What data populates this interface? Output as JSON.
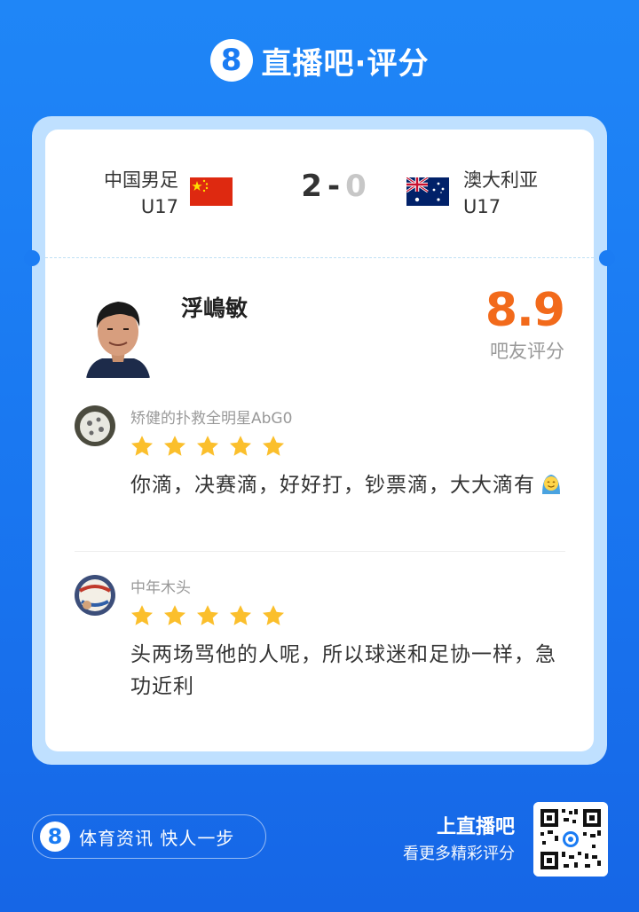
{
  "brand": {
    "badge": "8",
    "title": "直播吧·评分"
  },
  "match": {
    "home_name": "中国男足",
    "home_sub": "U17",
    "away_name": "澳大利亚",
    "away_sub": "U17",
    "home_score": "2",
    "separator": "-",
    "away_score": "0"
  },
  "player": {
    "name": "浮嶋敏",
    "rating": "8.9",
    "rating_label": "吧友评分"
  },
  "comments": [
    {
      "user": "矫健的扑救全明星AbG0",
      "stars": 5,
      "text": "你滴，决赛滴，好好打，钞票滴，大大滴有"
    },
    {
      "user": "中年木头",
      "stars": 5,
      "text": "头两场骂他的人呢，所以球迷和足协一样，急功近利"
    }
  ],
  "footer": {
    "pill_badge": "8",
    "pill_text": "体育资讯 快人一步",
    "cta_title": "上直播吧",
    "cta_sub": "看更多精彩评分"
  },
  "colors": {
    "accent": "#1b7cf3",
    "rating": "#f26a1b",
    "star": "#fbbf2c"
  },
  "icons": [
    "china-flag-icon",
    "australia-flag-icon",
    "star-icon",
    "smile-emoji-icon",
    "qr-code-icon"
  ]
}
